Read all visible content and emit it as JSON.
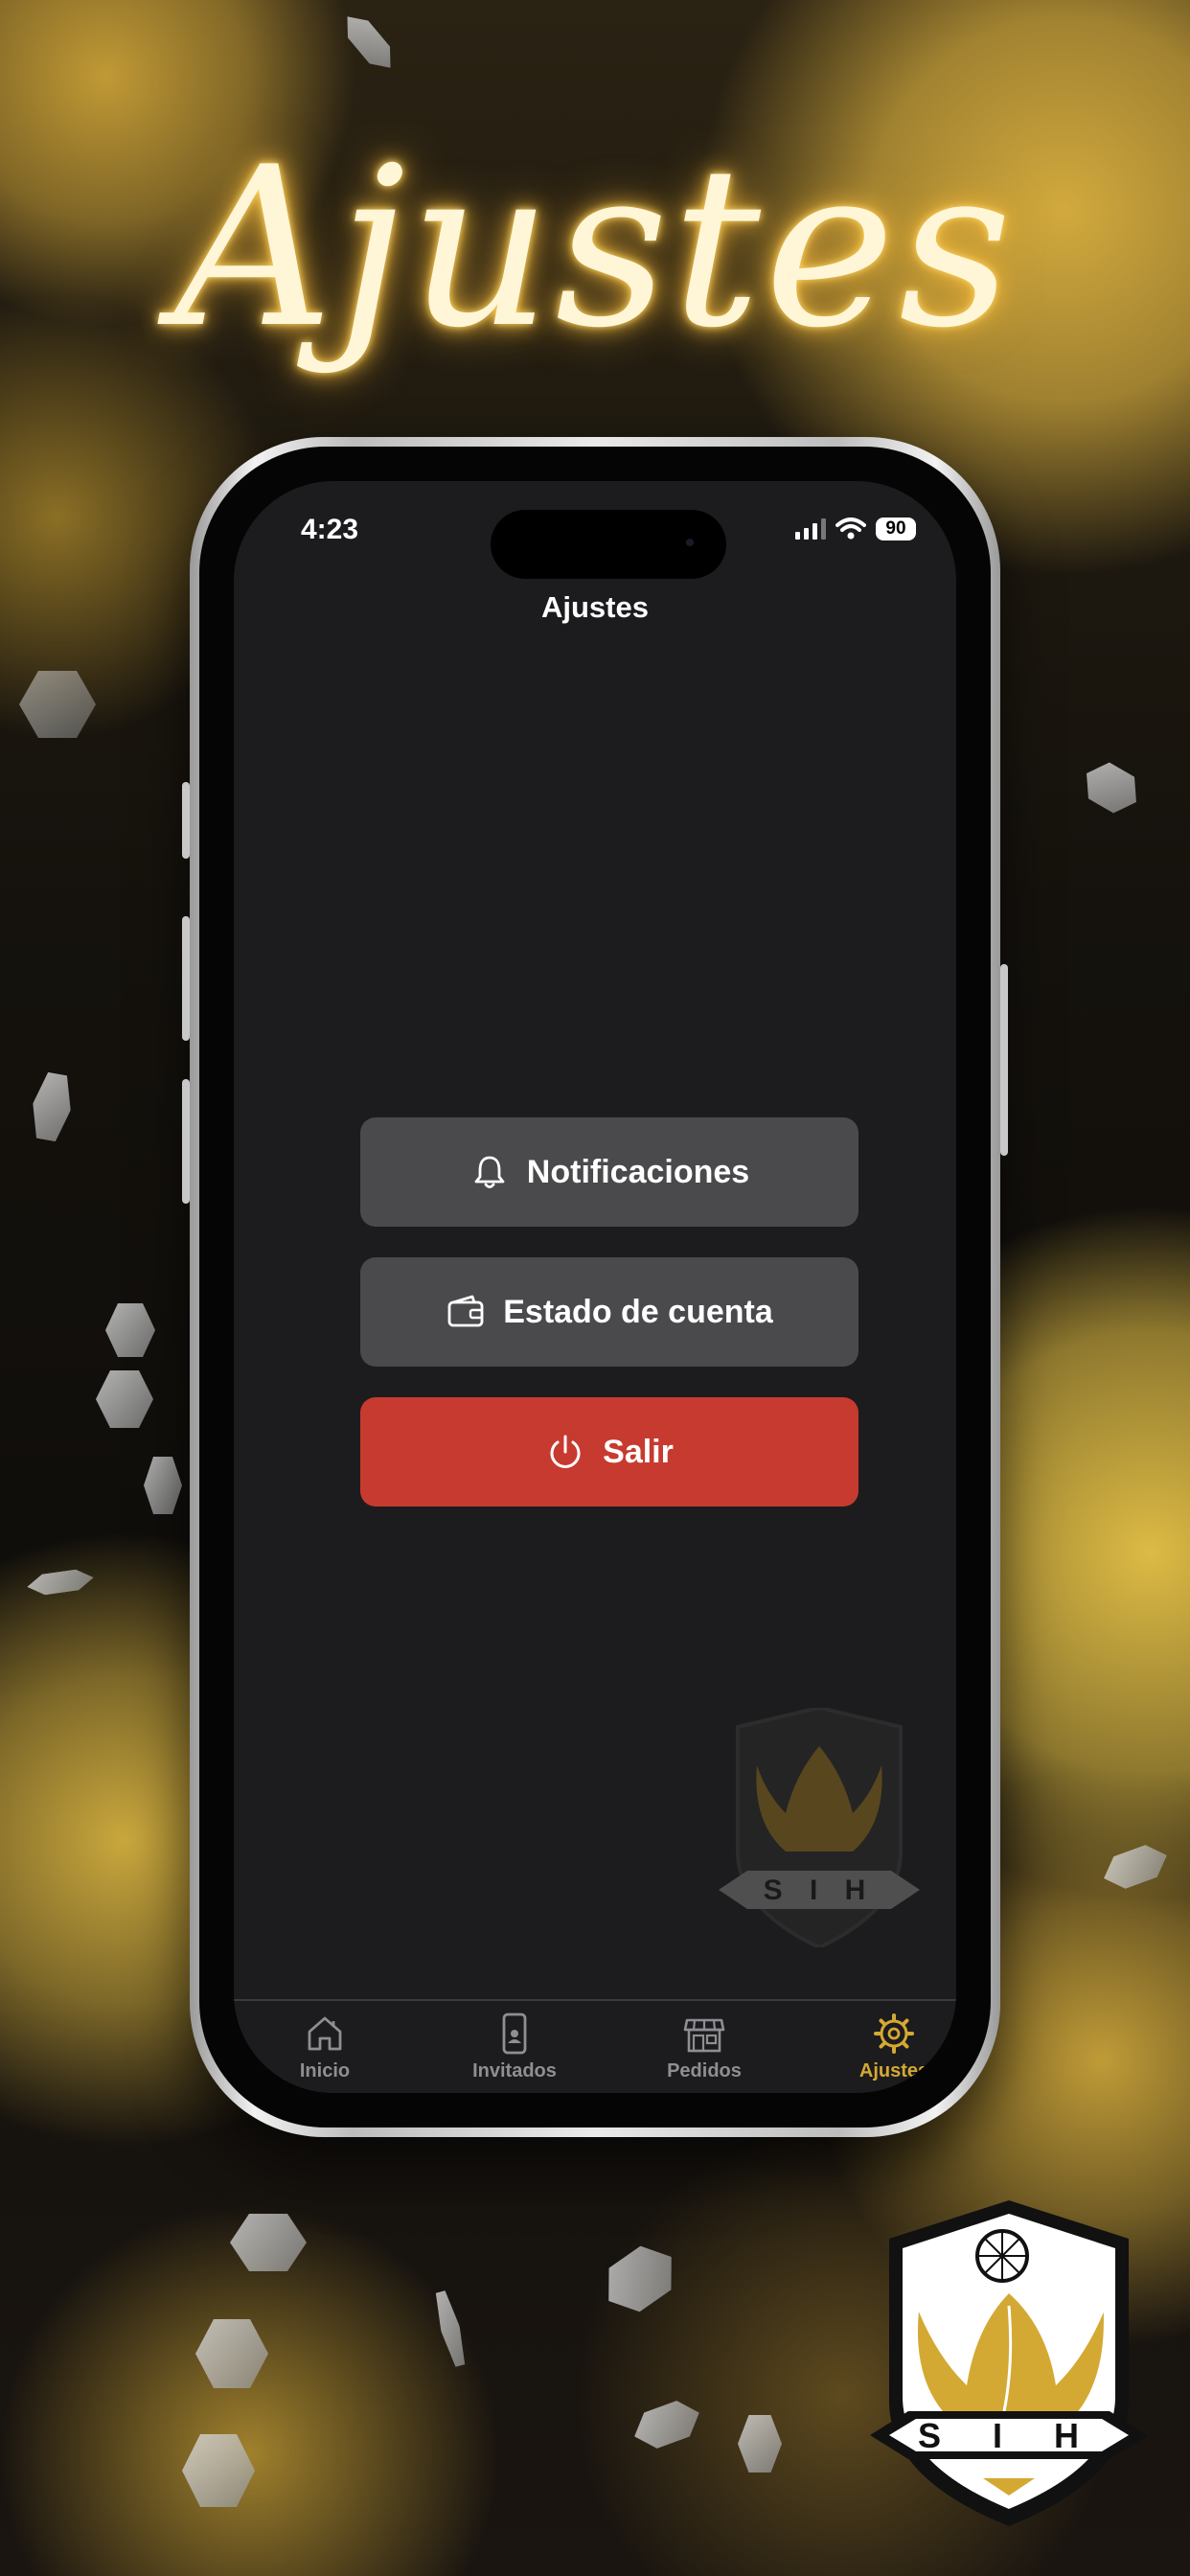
{
  "headline": "Ajustes",
  "status_bar": {
    "time": "4:23",
    "battery": "90"
  },
  "screen": {
    "title": "Ajustes"
  },
  "menu": {
    "notifications": "Notificaciones",
    "account_statement": "Estado de cuenta",
    "logout": "Salir"
  },
  "tabs": [
    {
      "label": "Inicio",
      "icon": "home-icon"
    },
    {
      "label": "Invitados",
      "icon": "phone-icon"
    },
    {
      "label": "Pedidos",
      "icon": "store-icon"
    },
    {
      "label": "Ajustes",
      "icon": "gear-icon",
      "active": true
    }
  ],
  "logo_text": "S I H",
  "colors": {
    "accent": "#d4a933",
    "danger": "#c73a2f",
    "button": "#4a4a4c",
    "screen": "#1c1c1e"
  }
}
